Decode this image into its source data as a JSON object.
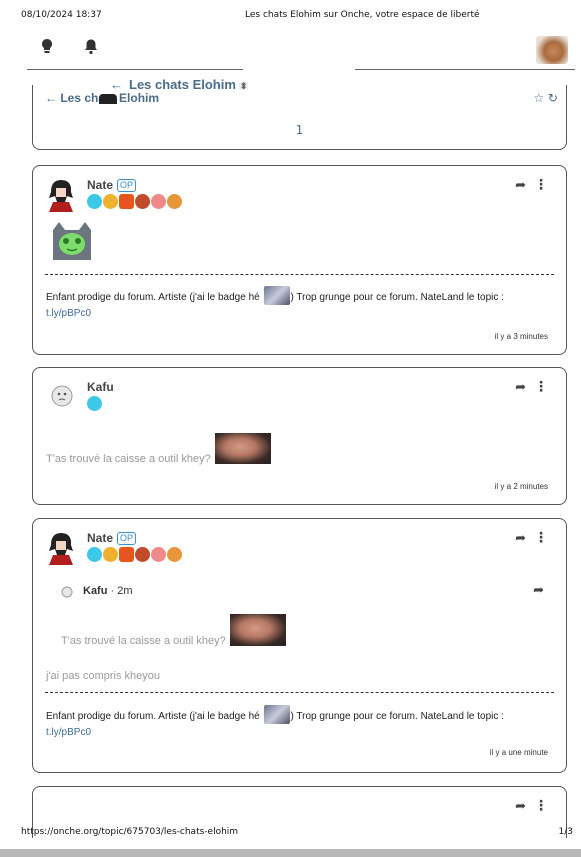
{
  "print_header": {
    "date": "08/10/2024 18:37",
    "title": "Les chats Elohim sur Onche, votre espace de liberté"
  },
  "print_footer": {
    "url": "https://onche.org/topic/675703/les-chats-elohim",
    "page": "1/3"
  },
  "nav": {
    "icons": [
      "lightbulb-icon",
      "bell-icon"
    ],
    "avatar": "user-avatar-dog"
  },
  "sticky_title": {
    "label": "Les chats Elohim",
    "arrow": "←",
    "updown": "⬍"
  },
  "topic_header": {
    "crumb": "Les chats Elohim",
    "arrow": "←",
    "page_number": "1",
    "icons": "☆  ↻"
  },
  "posts": [
    {
      "user": "Nate",
      "op_label": "OP",
      "badges": [
        "#3cc8e6",
        "#f0b030",
        "#e8541e",
        "#c04a2a",
        "#f08a8a",
        "#e8963a"
      ],
      "signature": {
        "before": "Enfant prodige du forum. Artiste (j'ai le badge hé",
        "after": ") Trop grunge pour ce forum. NateLand le topic :",
        "link": "t.ly/pBPc0"
      },
      "time": "il y a 3 minutes"
    },
    {
      "user": "Kafu",
      "badges": [
        "#3cc8e6"
      ],
      "message": "T'as trouvé la caisse a outil khey?",
      "time": "il y a 2 minutes"
    },
    {
      "user": "Nate",
      "op_label": "OP",
      "badges": [
        "#3cc8e6",
        "#f0b030",
        "#e8541e",
        "#c04a2a",
        "#f08a8a",
        "#e8963a"
      ],
      "quote": {
        "user": "Kafu",
        "age": " · 2m",
        "message": "T'as trouvé la caisse a outil khey?"
      },
      "message": "j'ai pas compris kheyou",
      "signature": {
        "before": "Enfant prodige du forum. Artiste (j'ai le badge hé",
        "after": ") Trop grunge pour ce forum. NateLand le topic :",
        "link": "t.ly/pBPc0"
      },
      "time": "il y a une minute"
    }
  ],
  "colors": {
    "accent": "#4a6b8a",
    "link": "#3b6a96",
    "op": "#3b8fd6"
  }
}
